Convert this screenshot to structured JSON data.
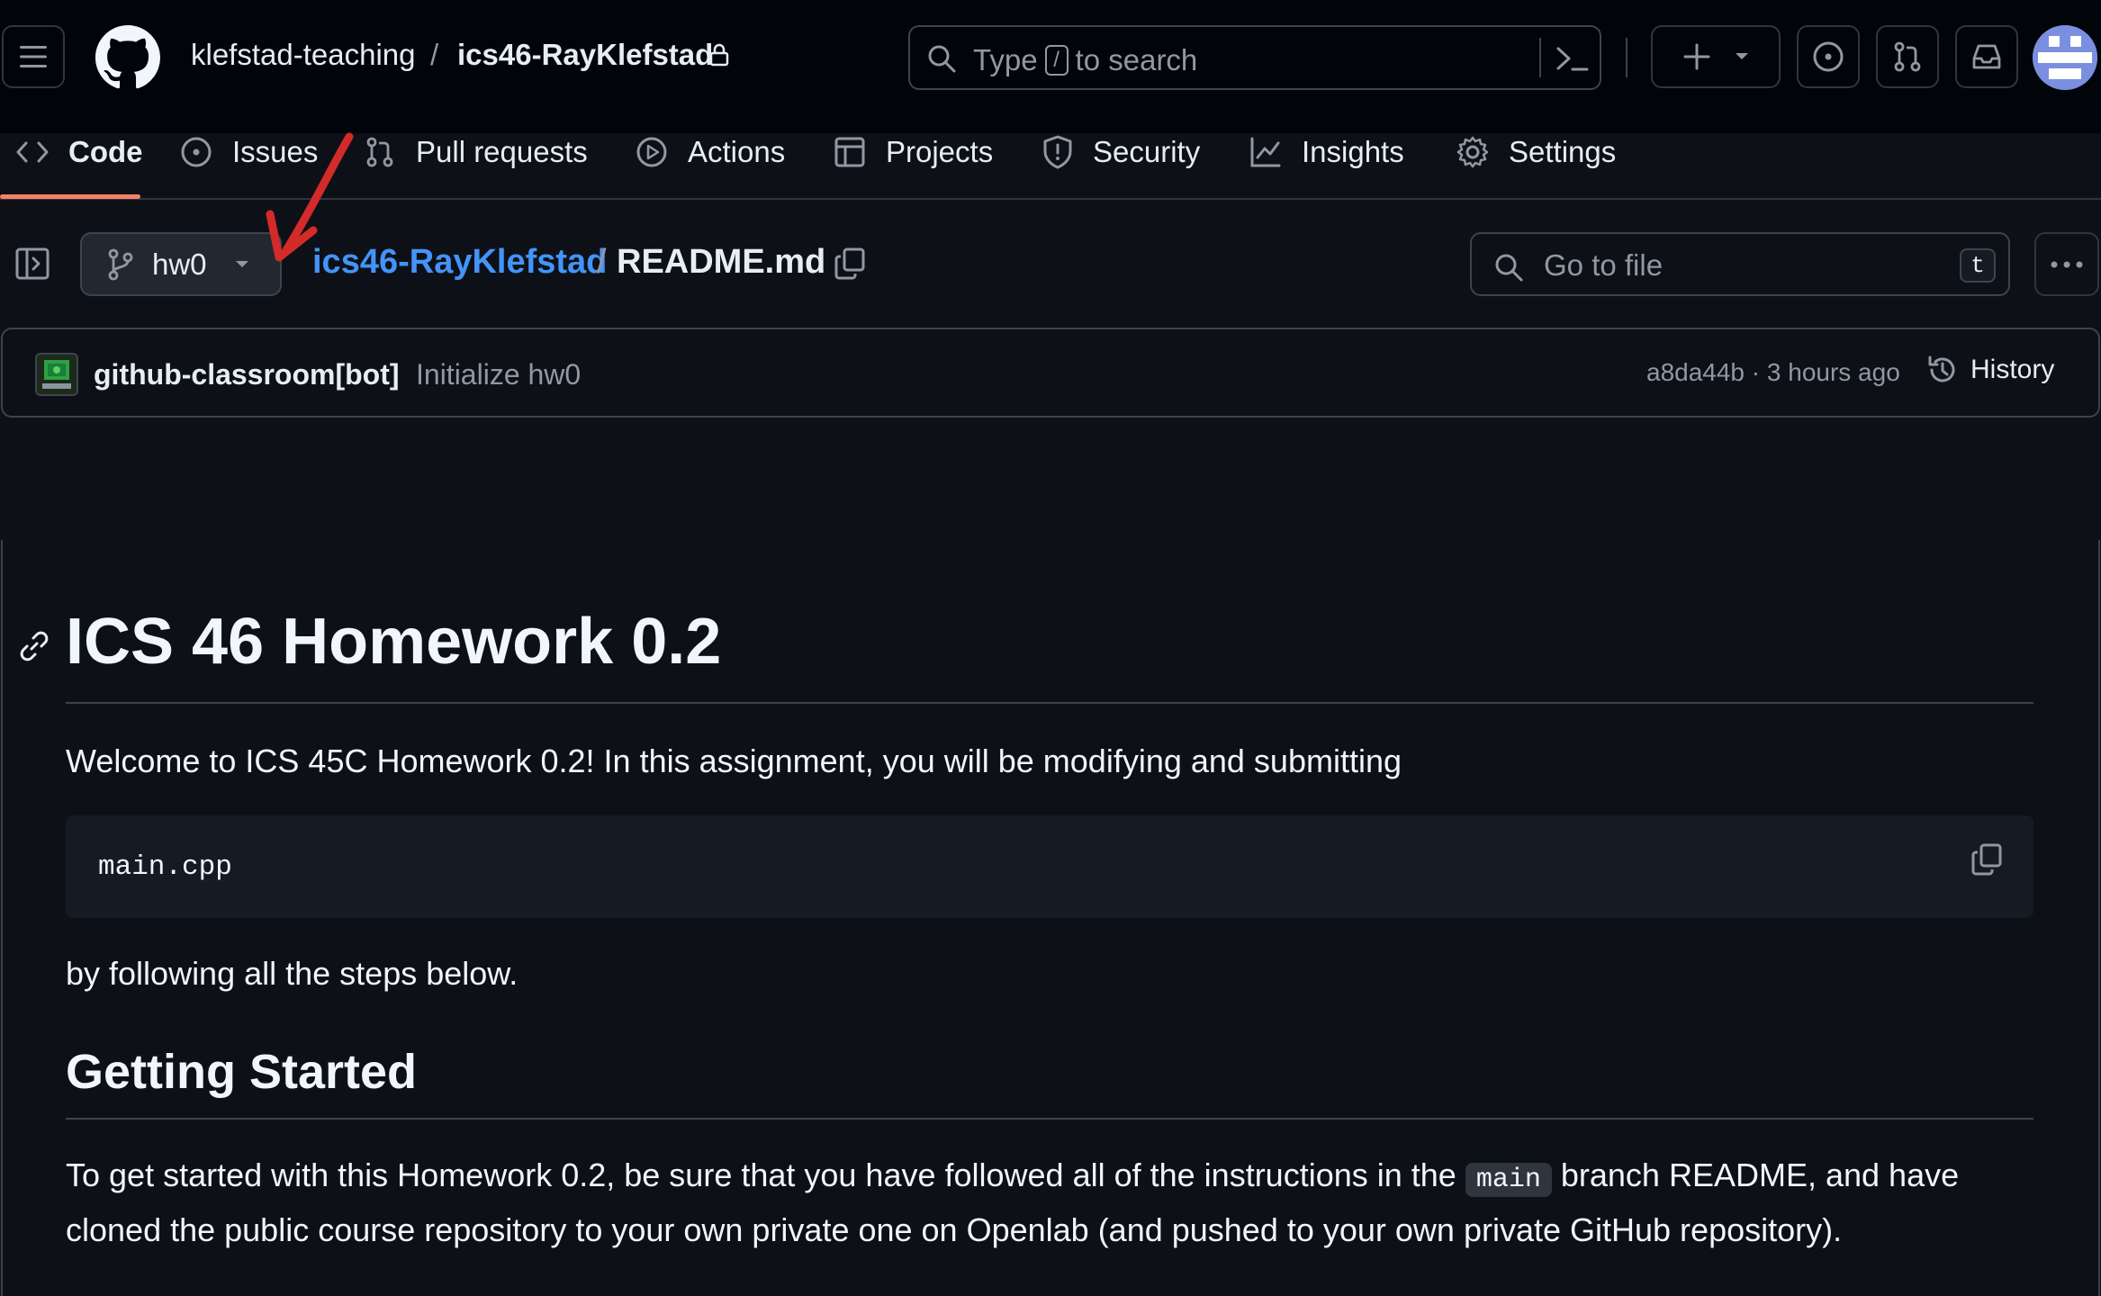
{
  "header": {
    "owner": "klefstad-teaching",
    "separator": "/",
    "repo": "ics46-RayKlefstad",
    "search_prefix": "Type",
    "search_key": "/",
    "search_suffix": "to search"
  },
  "tabs": [
    {
      "label": "Code",
      "icon": "code-icon"
    },
    {
      "label": "Issues",
      "icon": "issue-icon"
    },
    {
      "label": "Pull requests",
      "icon": "pull-request-icon"
    },
    {
      "label": "Actions",
      "icon": "play-icon"
    },
    {
      "label": "Projects",
      "icon": "table-icon"
    },
    {
      "label": "Security",
      "icon": "shield-icon"
    },
    {
      "label": "Insights",
      "icon": "graph-icon"
    },
    {
      "label": "Settings",
      "icon": "gear-icon"
    }
  ],
  "file_bar": {
    "branch": "hw0",
    "repo_crumb": "ics46-RayKlefstad",
    "crumb_sep": "/",
    "file_name": "README.md",
    "goto_placeholder": "Go to file",
    "goto_key": "t"
  },
  "commit": {
    "author": "github-classroom[bot]",
    "message": "Initialize hw0",
    "meta": "a8da44b · 3 hours ago",
    "history_label": "History"
  },
  "readme": {
    "title": "ICS 46 Homework 0.2",
    "intro": "Welcome to ICS 45C Homework 0.2! In this assignment, you will be modifying and submitting",
    "code": "main.cpp",
    "after_code": "by following all the steps below.",
    "h2": "Getting Started",
    "p2_before": "To get started with this Homework 0.2, be sure that you have followed all of the instructions in the",
    "p2_code": "main",
    "p2_after": "branch README, and have",
    "p2_line2": "cloned the public course repository to your own private one on Openlab (and pushed to your own private GitHub repository)."
  },
  "colors": {
    "accent_link": "#4493f8",
    "tab_underline": "#f78166",
    "annotation_arrow": "#d42a2a"
  }
}
